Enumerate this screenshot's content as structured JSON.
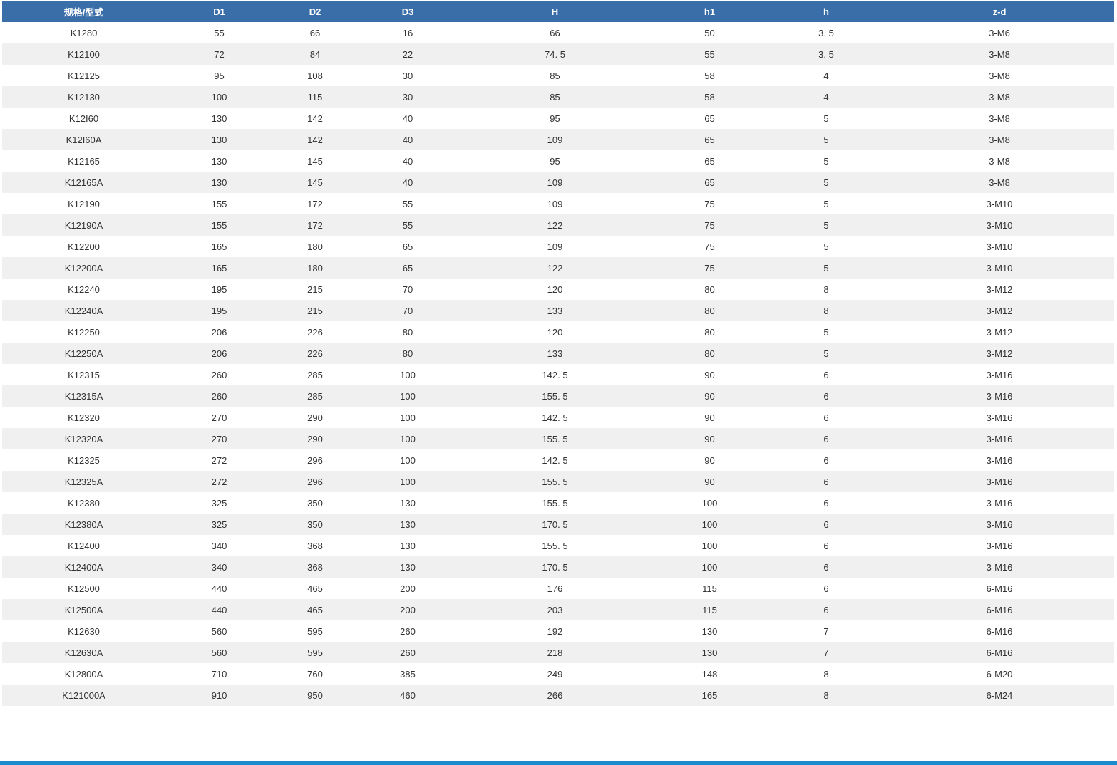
{
  "table": {
    "headers": [
      "规格/型式",
      "D1",
      "D2",
      "D3",
      "H",
      "h1",
      "h",
      "z-d"
    ],
    "rows": [
      [
        "K1280",
        "55",
        "66",
        "16",
        "66",
        "50",
        "3. 5",
        "3-M6"
      ],
      [
        "K12100",
        "72",
        "84",
        "22",
        "74. 5",
        "55",
        "3. 5",
        "3-M8"
      ],
      [
        "K12125",
        "95",
        "108",
        "30",
        "85",
        "58",
        "4",
        "3-M8"
      ],
      [
        "K12130",
        "100",
        "115",
        "30",
        "85",
        "58",
        "4",
        "3-M8"
      ],
      [
        "K12I60",
        "130",
        "142",
        "40",
        "95",
        "65",
        "5",
        "3-M8"
      ],
      [
        "K12I60A",
        "130",
        "142",
        "40",
        "109",
        "65",
        "5",
        "3-M8"
      ],
      [
        "K12165",
        "130",
        "145",
        "40",
        "95",
        "65",
        "5",
        "3-M8"
      ],
      [
        "K12165A",
        "130",
        "145",
        "40",
        "109",
        "65",
        "5",
        "3-M8"
      ],
      [
        "K12190",
        "155",
        "172",
        "55",
        "109",
        "75",
        "5",
        "3-M10"
      ],
      [
        "K12190A",
        "155",
        "172",
        "55",
        "122",
        "75",
        "5",
        "3-M10"
      ],
      [
        "K12200",
        "165",
        "180",
        "65",
        "109",
        "75",
        "5",
        "3-M10"
      ],
      [
        "K12200A",
        "165",
        "180",
        "65",
        "122",
        "75",
        "5",
        "3-M10"
      ],
      [
        "K12240",
        "195",
        "215",
        "70",
        "120",
        "80",
        "8",
        "3-M12"
      ],
      [
        "K12240A",
        "195",
        "215",
        "70",
        "133",
        "80",
        "8",
        "3-M12"
      ],
      [
        "K12250",
        "206",
        "226",
        "80",
        "120",
        "80",
        "5",
        "3-M12"
      ],
      [
        "K12250A",
        "206",
        "226",
        "80",
        "133",
        "80",
        "5",
        "3-M12"
      ],
      [
        "K12315",
        "260",
        "285",
        "100",
        "142. 5",
        "90",
        "6",
        "3-M16"
      ],
      [
        "K12315A",
        "260",
        "285",
        "100",
        "155. 5",
        "90",
        "6",
        "3-M16"
      ],
      [
        "K12320",
        "270",
        "290",
        "100",
        "142. 5",
        "90",
        "6",
        "3-M16"
      ],
      [
        "K12320A",
        "270",
        "290",
        "100",
        "155. 5",
        "90",
        "6",
        "3-M16"
      ],
      [
        "K12325",
        "272",
        "296",
        "100",
        "142. 5",
        "90",
        "6",
        "3-M16"
      ],
      [
        "K12325A",
        "272",
        "296",
        "100",
        "155. 5",
        "90",
        "6",
        "3-M16"
      ],
      [
        "K12380",
        "325",
        "350",
        "130",
        "155. 5",
        "100",
        "6",
        "3-M16"
      ],
      [
        "K12380A",
        "325",
        "350",
        "130",
        "170. 5",
        "100",
        "6",
        "3-M16"
      ],
      [
        "K12400",
        "340",
        "368",
        "130",
        "155. 5",
        "100",
        "6",
        "3-M16"
      ],
      [
        "K12400A",
        "340",
        "368",
        "130",
        "170. 5",
        "100",
        "6",
        "3-M16"
      ],
      [
        "K12500",
        "440",
        "465",
        "200",
        "176",
        "115",
        "6",
        "6-M16"
      ],
      [
        "K12500A",
        "440",
        "465",
        "200",
        "203",
        "115",
        "6",
        "6-M16"
      ],
      [
        "K12630",
        "560",
        "595",
        "260",
        "192",
        "130",
        "7",
        "6-M16"
      ],
      [
        "K12630A",
        "560",
        "595",
        "260",
        "218",
        "130",
        "7",
        "6-M16"
      ],
      [
        "K12800A",
        "710",
        "760",
        "385",
        "249",
        "148",
        "8",
        "6-M20"
      ],
      [
        "K121000A",
        "910",
        "950",
        "460",
        "266",
        "165",
        "8",
        "6-M24"
      ]
    ]
  },
  "colors": {
    "header_bg": "#3a6ea8",
    "header_text": "#ffffff",
    "stripe_bg": "#f0f0f0",
    "bottom_bar": "#1e8ccc"
  }
}
